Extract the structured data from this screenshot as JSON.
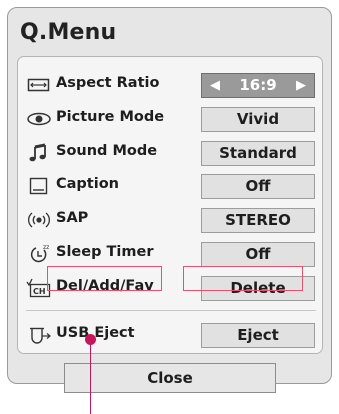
{
  "title": "Q.Menu",
  "items": [
    {
      "label": "Aspect Ratio",
      "value": "16:9",
      "icon": "aspect-ratio-icon"
    },
    {
      "label": "Picture Mode",
      "value": "Vivid",
      "icon": "eye-icon"
    },
    {
      "label": "Sound Mode",
      "value": "Standard",
      "icon": "music-note-icon"
    },
    {
      "label": "Caption",
      "value": "Off",
      "icon": "caption-icon"
    },
    {
      "label": "SAP",
      "value": "STEREO",
      "icon": "sap-audio-icon"
    },
    {
      "label": "Sleep Timer",
      "value": "Off",
      "icon": "sleep-timer-icon"
    },
    {
      "label": "Del/Add/Fav",
      "value": "Delete",
      "icon": "channel-edit-icon"
    }
  ],
  "usb": {
    "label": "USB Eject",
    "value": "Eject",
    "icon": "usb-eject-icon"
  },
  "close_label": "Close",
  "colors": {
    "selected_bg": "#9a9a9a",
    "highlight_border": "#e3526e",
    "pointer": "#c2185b"
  }
}
